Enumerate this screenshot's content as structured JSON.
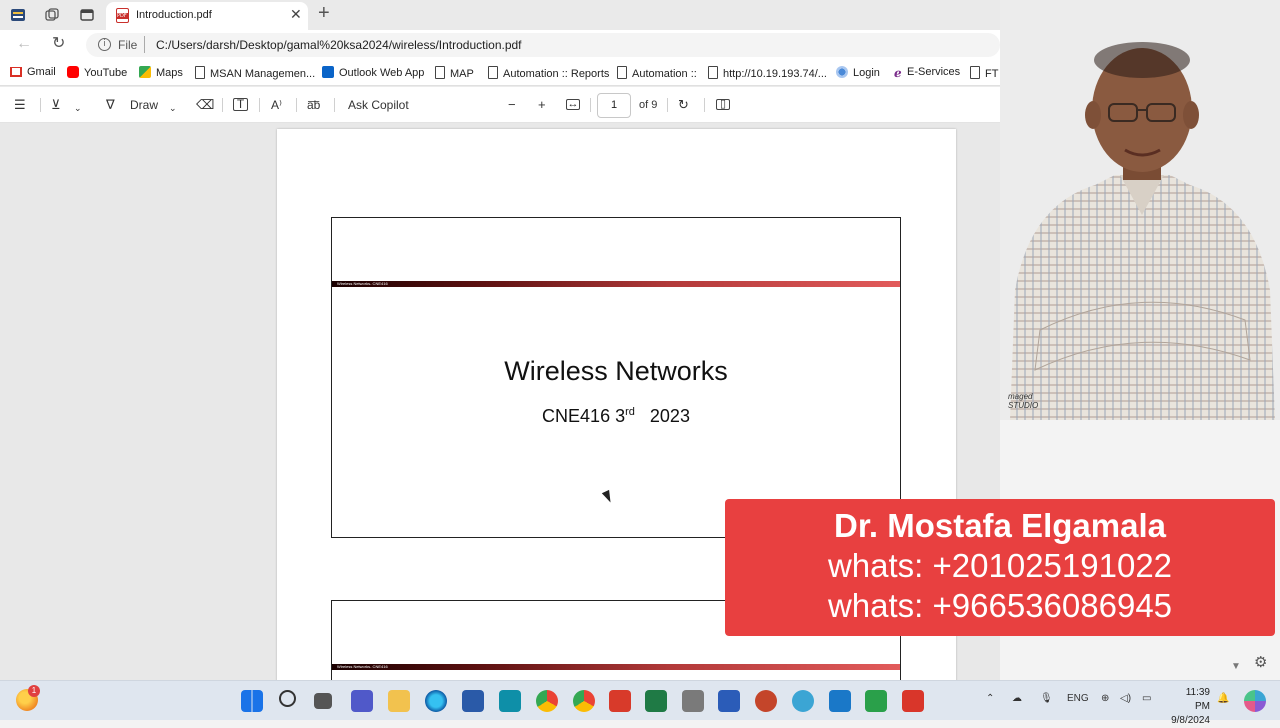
{
  "tabs": [
    {
      "title": "Introduction.pdf"
    }
  ],
  "address": {
    "scheme": "File",
    "url": "C:/Users/darsh/Desktop/gamal%20ksa2024/wireless/Introduction.pdf"
  },
  "bookmarks": [
    {
      "label": "Gmail",
      "icon": "gmail-icon"
    },
    {
      "label": "YouTube",
      "icon": "youtube-icon"
    },
    {
      "label": "Maps",
      "icon": "maps-icon"
    },
    {
      "label": "MSAN Managemen...",
      "icon": "page-icon"
    },
    {
      "label": "Outlook Web App",
      "icon": "outlook-icon"
    },
    {
      "label": "MAP",
      "icon": "page-icon"
    },
    {
      "label": "Automation :: Reports",
      "icon": "page-icon"
    },
    {
      "label": "Automation ::",
      "icon": "page-icon"
    },
    {
      "label": "http://10.19.193.74/...",
      "icon": "page-icon"
    },
    {
      "label": "Login",
      "icon": "login-icon"
    },
    {
      "label": "E-Services",
      "icon": "eservices-icon"
    },
    {
      "label": "FT",
      "icon": "page-icon"
    }
  ],
  "pdf_toolbar": {
    "draw_label": "Draw",
    "copilot_label": "Ask Copilot",
    "page_number": "1",
    "page_total": "of 9"
  },
  "slide1": {
    "band_text": "Wireless Networks- CNE416",
    "title": "Wireless Networks",
    "subtitle_course": "CNE416 3",
    "subtitle_sup": "rd",
    "subtitle_year": "2023"
  },
  "slide2": {
    "band_text": "Wireless Networks- CNE416"
  },
  "webcam": {
    "studio_logo_line1": "maged",
    "studio_logo_line2": "STUDIO"
  },
  "banner": {
    "name": "Dr. Mostafa Elgamala",
    "whats1": "whats: +201025191022",
    "whats2": "whats: +966536086945"
  },
  "taskbar": {
    "edge_badge": "1",
    "lang": "ENG",
    "time": "11:39 PM",
    "date": "9/8/2024"
  },
  "colors": {
    "banner_bg": "#e84040",
    "slide_band_start": "#1a0000",
    "slide_band_end": "#e25b5b"
  }
}
